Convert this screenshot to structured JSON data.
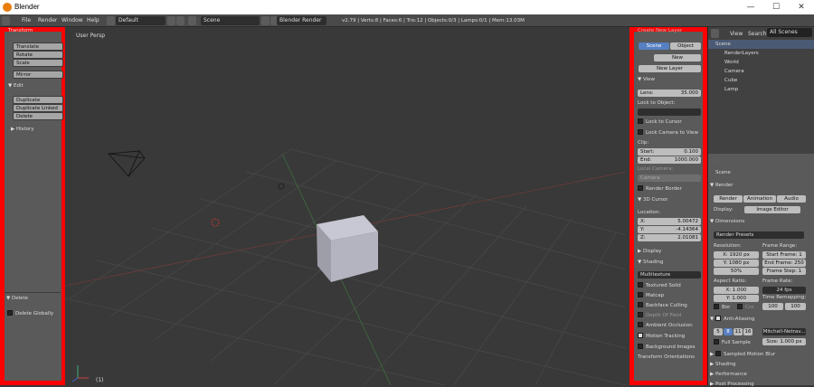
{
  "window": {
    "title": "Blender",
    "minimize": "—",
    "maximize": "☐",
    "close": "✕"
  },
  "infobar": {
    "menus": [
      "File",
      "Render",
      "Window",
      "Help"
    ],
    "layout": "Default",
    "scene": "Scene",
    "engine": "Blender Render",
    "stats": "v2.79 | Verts:8 | Faces:6 | Tris:12 | Objects:0/3 | Lamps:0/1 | Mem:13.03M"
  },
  "toolshelf": {
    "transform_header": "Transform",
    "transform_buttons": [
      "Translate",
      "Rotate",
      "Scale"
    ],
    "mirror": "Mirror",
    "edit_header": "▼ Edit",
    "edit_buttons": [
      "Duplicate",
      "Duplicate Linked",
      "Delete"
    ],
    "history": "▶ History",
    "delete_header": "▼ Delete",
    "delete_globally": "Delete Globally"
  },
  "viewport": {
    "label": "User Persp",
    "frame": "(1)"
  },
  "props": {
    "top_label": "Create New Layer",
    "scene_btn": "Scene",
    "object_btn": "Object",
    "new": "New",
    "new_layer": "New Layer",
    "view_header": "▼ View",
    "lens_label": "Lens:",
    "lens_value": "35.000",
    "lock_obj": "Lock to Object:",
    "lock_cursor": "Lock to Cursor",
    "lock_camera": "Lock Camera to View",
    "clip": "Clip:",
    "start_label": "Start:",
    "start_value": "0.100",
    "end_label": "End:",
    "end_value": "1000.000",
    "local_camera": "Local Camera:",
    "camera_field": "Camera",
    "render_border": "Render Border",
    "cursor_header": "▼ 3D Cursor",
    "location": "Location:",
    "x_label": "X:",
    "x_value": "5.00472",
    "y_label": "Y:",
    "y_value": "-4.14364",
    "z_label": "Z:",
    "z_value": "2.01081",
    "display": "▶ Display",
    "shading": "▼ Shading",
    "shading_mode": "Multitexture",
    "textured_solid": "Textured Solid",
    "matcap": "Matcap",
    "backface": "Backface Culling",
    "dof": "Depth Of Field",
    "ambient": "Ambient Occlusion",
    "motion_tracking": "Motion Tracking",
    "bg_images": "Background Images",
    "transform_orient": "Transform Orientations"
  },
  "outliner": {
    "tabs": [
      "View",
      "Search",
      "All Scenes"
    ],
    "items": [
      "Scene",
      "RenderLayers",
      "World",
      "Camera",
      "Cube",
      "Lamp"
    ]
  },
  "render": {
    "scene": "Scene",
    "render_header": "▼ Render",
    "render_btn": "Render",
    "animation_btn": "Animation",
    "audio_btn": "Audio",
    "display_label": "Display:",
    "display_value": "Image Editor",
    "dimensions": "▼ Dimensions",
    "presets": "Render Presets",
    "resolution": "Resolution:",
    "res_x": "X: 1920 px",
    "res_y": "Y: 1080 px",
    "res_pct": "50%",
    "frame_range": "Frame Range:",
    "start_frame": "Start Frame: 1",
    "end_frame": "End Frame: 250",
    "frame_step": "Frame Step: 1",
    "aspect": "Aspect Ratio:",
    "asp_x": "X: 1.000",
    "asp_y": "Y: 1.000",
    "frame_rate": "Frame Rate:",
    "fps": "24 fps",
    "time_remap": "Time Remapping:",
    "remap_old": "100",
    "remap_new": "100",
    "bor": "Bor",
    "cro": "Cro",
    "aa_header": "Anti-Aliasing",
    "aa_samples": [
      "5",
      "8",
      "11",
      "16"
    ],
    "aa_filter": "Mitchell-Netrav...",
    "full_sample": "Full Sample",
    "size": "Size: 1.000 px",
    "motion_blur": "Sampled Motion Blur",
    "shading": "▶ Shading",
    "performance": "▶ Performance",
    "post": "▶ Post Processing"
  },
  "colors": {
    "highlight": "#ff0000",
    "selected": "#5680c2"
  }
}
